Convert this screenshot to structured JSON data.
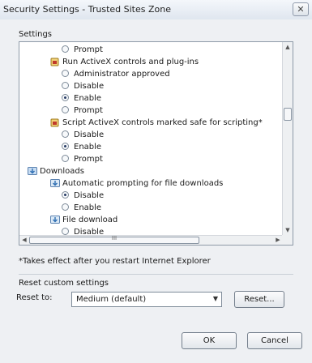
{
  "window": {
    "title": "Security Settings - Trusted Sites Zone",
    "close_glyph": "✕"
  },
  "settings": {
    "label": "Settings",
    "items": [
      {
        "type": "radio",
        "label": "Prompt",
        "checked": false
      },
      {
        "type": "group",
        "label": "Run ActiveX controls and plug-ins",
        "icon": "activex-icon"
      },
      {
        "type": "radio",
        "label": "Administrator approved",
        "checked": false
      },
      {
        "type": "radio",
        "label": "Disable",
        "checked": false
      },
      {
        "type": "radio",
        "label": "Enable",
        "checked": true
      },
      {
        "type": "radio",
        "label": "Prompt",
        "checked": false
      },
      {
        "type": "group",
        "label": "Script ActiveX controls marked safe for scripting*",
        "icon": "activex-icon"
      },
      {
        "type": "radio",
        "label": "Disable",
        "checked": false
      },
      {
        "type": "radio",
        "label": "Enable",
        "checked": true
      },
      {
        "type": "radio",
        "label": "Prompt",
        "checked": false
      },
      {
        "type": "category",
        "label": "Downloads",
        "icon": "downloads-icon"
      },
      {
        "type": "group",
        "label": "Automatic prompting for file downloads",
        "icon": "download-setting-icon"
      },
      {
        "type": "radio",
        "label": "Disable",
        "checked": true
      },
      {
        "type": "radio",
        "label": "Enable",
        "checked": false
      },
      {
        "type": "group",
        "label": "File download",
        "icon": "download-setting-icon"
      },
      {
        "type": "radio",
        "label": "Disable",
        "checked": false
      }
    ],
    "hscroll_grip": "III"
  },
  "note": "*Takes effect after you restart Internet Explorer",
  "reset": {
    "title": "Reset custom settings",
    "label": "Reset to:",
    "selected": "Medium (default)",
    "button": "Reset..."
  },
  "buttons": {
    "ok": "OK",
    "cancel": "Cancel"
  },
  "colors": {
    "accent": "#263a63",
    "titlebar": "#dfe6ef",
    "background": "#eef0f3"
  }
}
